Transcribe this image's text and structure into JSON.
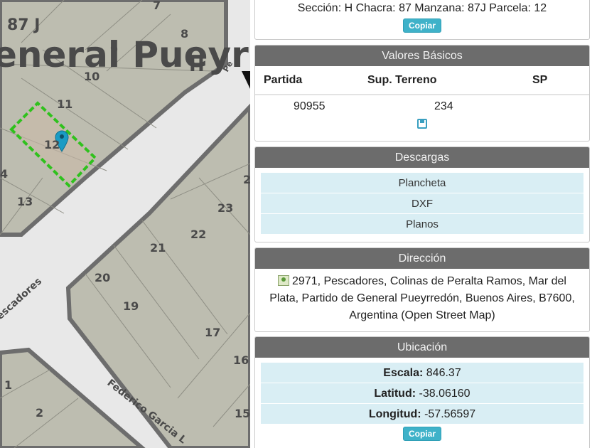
{
  "map": {
    "title": "eneral Pueyr",
    "block_label": "87 J",
    "section_letter": "H",
    "street_1": "escadores",
    "street_2": "Federico Garcia L",
    "street_3": "Pe",
    "lots": [
      "7",
      "8",
      "9",
      "10",
      "11",
      "12",
      "13",
      "4",
      "23",
      "22",
      "21",
      "20",
      "19",
      "17",
      "16",
      "15",
      "1",
      "2",
      "2"
    ]
  },
  "header_section": {
    "text": "Sección: H Chacra: 87 Manzana: 87J Parcela: 12",
    "copy_label": "Copiar"
  },
  "valores": {
    "title": "Valores Básicos",
    "columns": [
      "Partida",
      "Sup. Terreno",
      "SP"
    ],
    "row": [
      "90955",
      "234",
      ""
    ],
    "save_icon": "floppy-icon"
  },
  "descargas": {
    "title": "Descargas",
    "items": [
      "Plancheta",
      "DXF",
      "Planos"
    ]
  },
  "direccion": {
    "title": "Dirección",
    "line1": "2971, Pescadores, Colinas de Peralta Ramos, Mar del",
    "line2": "Plata, Partido de General Pueyrredón, Buenos Aires, B7600,",
    "line3": "Argentina (Open Street Map)",
    "icon": "map-icon"
  },
  "ubicacion": {
    "title": "Ubicación",
    "escala_label": "Escala:",
    "escala_value": "846.37",
    "latitud_label": "Latitud:",
    "latitud_value": "-38.06160",
    "longitud_label": "Longitud:",
    "longitud_value": "-57.56597",
    "copy_label": "Copiar"
  },
  "colors": {
    "header_bg": "#6c6c6c",
    "button": "#3fb2c9",
    "row_bg": "#d9eef4",
    "parcel_outline": "#2fc11d",
    "marker": "#1a9bc4"
  }
}
